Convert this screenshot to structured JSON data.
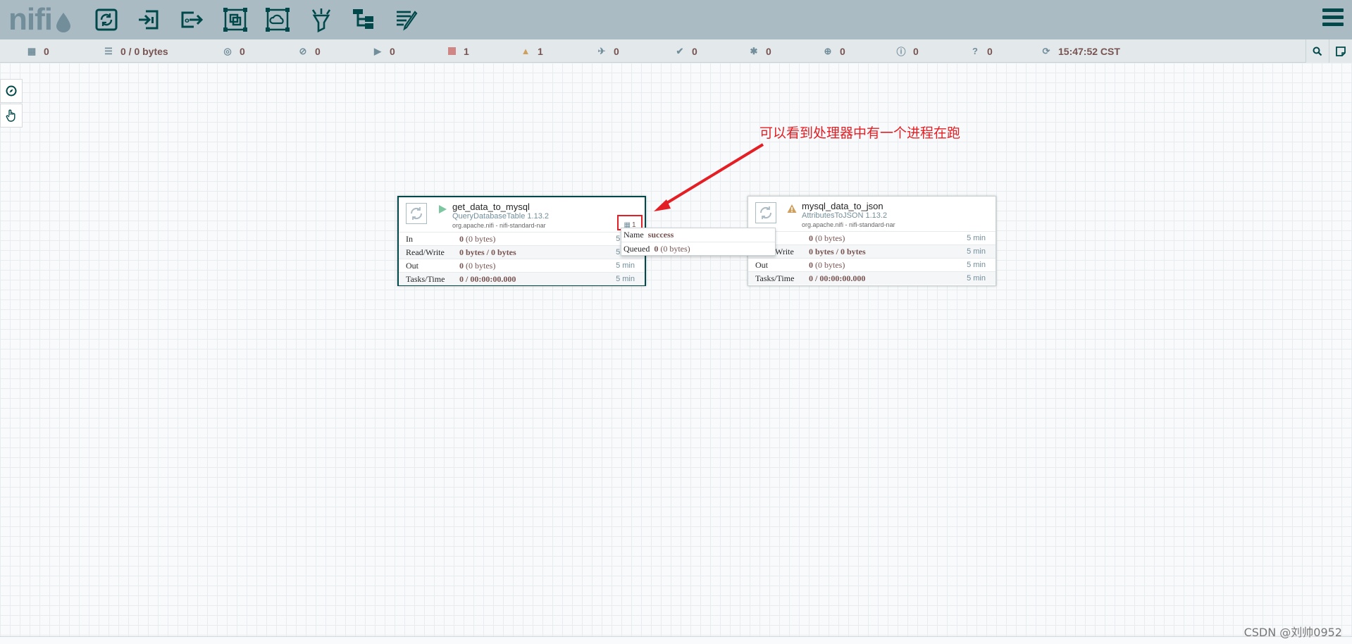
{
  "app": {
    "logo_text": "nifi"
  },
  "toolbar": {
    "tools": [
      {
        "name": "processor-tool-icon"
      },
      {
        "name": "input-port-tool-icon"
      },
      {
        "name": "output-port-tool-icon"
      },
      {
        "name": "process-group-tool-icon"
      },
      {
        "name": "remote-process-group-tool-icon"
      },
      {
        "name": "funnel-tool-icon"
      },
      {
        "name": "template-tool-icon"
      },
      {
        "name": "label-tool-icon"
      }
    ]
  },
  "status": {
    "active_threads": "0",
    "queued": "0 / 0 bytes",
    "transmitting": "0",
    "not_transmitting": "0",
    "running": "0",
    "stopped": "1",
    "invalid": "1",
    "disabled": "0",
    "up_to_date": "0",
    "locally_modified": "0",
    "stale": "0",
    "locally_modified_stale": "0",
    "sync_failure": "0",
    "refresh_time": "15:47:52 CST"
  },
  "processors": [
    {
      "name": "get_data_to_mysql",
      "type": "QueryDatabaseTable 1.13.2",
      "bundle": "org.apache.nifi - nifi-standard-nar",
      "state": "running",
      "in_val": "0",
      "in_sub": "(0 bytes)",
      "in_time": "5 min",
      "rw_val": "0 bytes / 0 bytes",
      "rw_time": "5 min",
      "out_val": "0",
      "out_sub": "(0 bytes)",
      "out_time": "5 min",
      "tasks_val": "0 / 00:00:00.000",
      "tasks_time": "5 min",
      "active_threads": "1"
    },
    {
      "name": "mysql_data_to_json",
      "type": "AttributesToJSON 1.13.2",
      "bundle": "org.apache.nifi - nifi-standard-nar",
      "state": "invalid",
      "in_val": "0",
      "in_sub": "(0 bytes)",
      "in_time": "5 min",
      "rw_val": "0 bytes / 0 bytes",
      "rw_time": "5 min",
      "out_val": "0",
      "out_sub": "(0 bytes)",
      "out_time": "5 min",
      "tasks_val": "0 / 00:00:00.000",
      "tasks_time": "5 min"
    }
  ],
  "labels": {
    "in": "In",
    "rw": "Read/Write",
    "out": "Out",
    "tasks": "Tasks/Time"
  },
  "connection_tooltip": {
    "name_label": "Name",
    "name_value": "success",
    "queued_label": "Queued",
    "queued_value": "0",
    "queued_sub": "(0 bytes)"
  },
  "annotation": "可以看到处理器中有一个进程在跑",
  "watermark": "CSDN @刘帅0952",
  "colors": {
    "header": "#aabbc3",
    "accent": "#004849",
    "value": "#775351",
    "annotation": "#e31e24"
  }
}
